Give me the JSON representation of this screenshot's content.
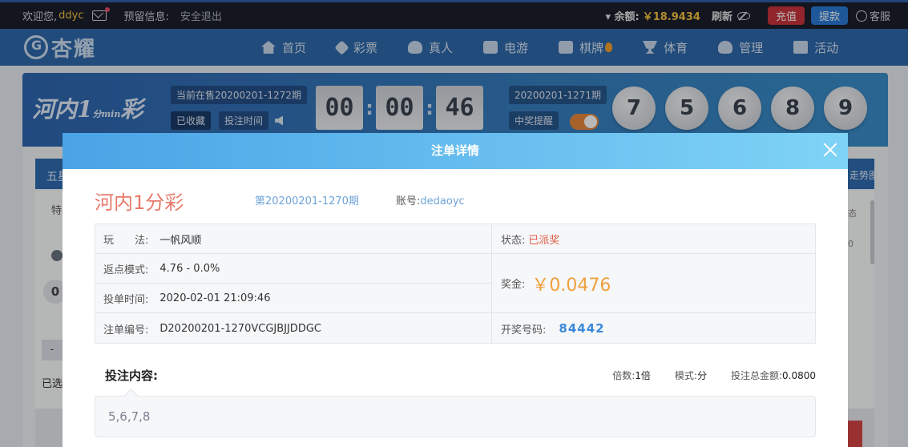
{
  "topbar": {
    "welcome": "欢迎您,",
    "username": "ddyc",
    "notice_label": "预留信息:",
    "logout": "安全退出",
    "balance_label": "余额:",
    "balance": "￥18.9434",
    "refresh": "刷新",
    "charge": "充值",
    "withdraw": "提款",
    "service": "客服"
  },
  "nav": {
    "logo": "杏耀",
    "items": [
      {
        "label": "首页",
        "icon": "home-icon"
      },
      {
        "label": "彩票",
        "icon": "tag-icon"
      },
      {
        "label": "真人",
        "icon": "person-icon"
      },
      {
        "label": "电游",
        "icon": "game-icon"
      },
      {
        "label": "棋牌",
        "icon": "cards-icon"
      },
      {
        "label": "体育",
        "icon": "trophy-icon"
      },
      {
        "label": "管理",
        "icon": "users-icon"
      },
      {
        "label": "活动",
        "icon": "gift-icon"
      }
    ]
  },
  "lottery": {
    "logo_text": "河内",
    "logo_num": "1",
    "logo_sub": "分min",
    "logo_tail": "彩",
    "current": "当前在售20200201-1272期",
    "fav": "已收藏",
    "bet_time": "投注时间",
    "clock": [
      "00",
      "00",
      "46"
    ],
    "prev_period": "20200201-1271期",
    "win_remind": "中奖提醒",
    "balls": [
      "7",
      "5",
      "6",
      "8",
      "9"
    ]
  },
  "background": {
    "tab": "五星",
    "right": "走势图",
    "t1": "特",
    "zero": "0",
    "minus": "-",
    "selected": "已选",
    "faint1": "态",
    "faint2": "0"
  },
  "modal": {
    "title": "注单详情",
    "game": "河内1分彩",
    "period": "第20200201-1270期",
    "account_label": "账号:",
    "account": "dedaoyc",
    "play_label": "玩　　法:",
    "play": "一帆风顺",
    "rebate_label": "返点模式:",
    "rebate": "4.76 - 0.0%",
    "time_label": "投单时间:",
    "time": "2020-02-01 21:09:46",
    "order_label": "注单编号:",
    "order": "D20200201-1270VCGJBJJDDGC",
    "status_label": "状态:",
    "status": "已派奖",
    "prize_label": "奖金:",
    "prize": "￥0.0476",
    "draw_label": "开奖号码:",
    "draw": "84442",
    "bet_label": "投注内容:",
    "multiple_label": "倍数:",
    "multiple": "1倍",
    "mode_label": "模式:",
    "mode": "分",
    "total_label": "投注总金额:",
    "total": "0.0800",
    "content": "5,6,7,8"
  },
  "colors": {
    "accent": "#4aa4e6",
    "title": "#e87a6a",
    "status": "#e05a44",
    "prize": "#eea13d",
    "draw": "#3a8ad8"
  }
}
